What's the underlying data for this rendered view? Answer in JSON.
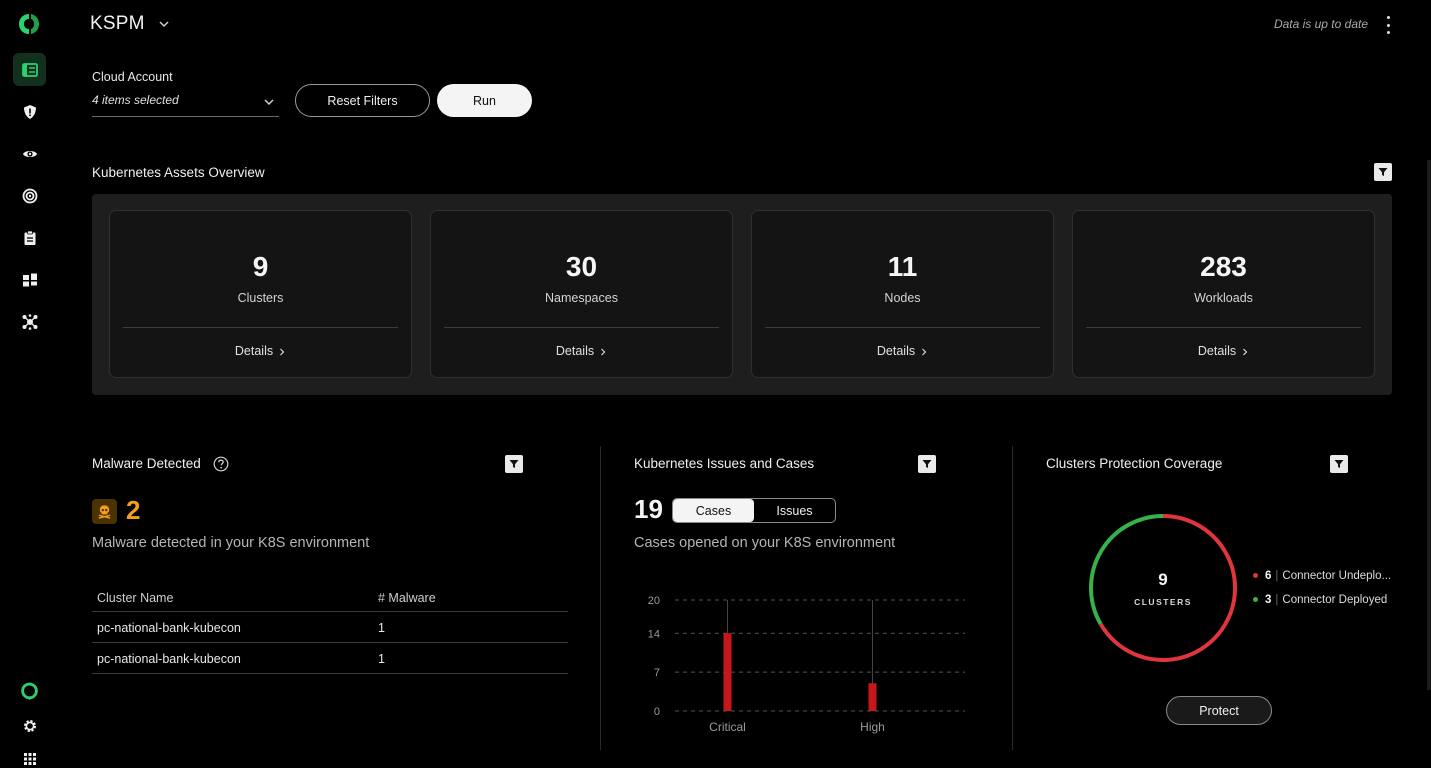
{
  "app": {
    "title": "KSPM",
    "status": "Data is up to date"
  },
  "colors": {
    "accent_green": "#2bd16a",
    "malware_orange": "#f5a015",
    "critical_red": "#e0353c",
    "deployed_green": "#36b24a"
  },
  "sidebar": {
    "items": [
      {
        "icon": "dashboard-icon"
      },
      {
        "icon": "shield-icon"
      },
      {
        "icon": "eye-icon"
      },
      {
        "icon": "target-icon"
      },
      {
        "icon": "clipboard-icon"
      },
      {
        "icon": "assets-icon"
      },
      {
        "icon": "network-icon"
      }
    ],
    "bottom": [
      {
        "icon": "assistant-icon"
      },
      {
        "icon": "gear-icon"
      },
      {
        "icon": "apps-grid-icon"
      }
    ]
  },
  "filters": {
    "label": "Cloud Account",
    "value": "4 items selected",
    "reset_label": "Reset Filters",
    "run_label": "Run"
  },
  "overview": {
    "title": "Kubernetes Assets Overview",
    "cards": [
      {
        "value": "9",
        "label": "Clusters",
        "details": "Details"
      },
      {
        "value": "30",
        "label": "Namespaces",
        "details": "Details"
      },
      {
        "value": "11",
        "label": "Nodes",
        "details": "Details"
      },
      {
        "value": "283",
        "label": "Workloads",
        "details": "Details"
      }
    ]
  },
  "malware": {
    "title": "Malware Detected",
    "count": "2",
    "description": "Malware detected in your K8S environment",
    "columns": [
      "Cluster Name",
      "# Malware"
    ],
    "rows": [
      [
        "pc-national-bank-kubecon",
        "1"
      ],
      [
        "pc-national-bank-kubecon",
        "1"
      ]
    ]
  },
  "issues": {
    "title": "Kubernetes Issues and Cases",
    "count": "19",
    "tabs": [
      "Cases",
      "Issues"
    ],
    "active_tab": "Cases",
    "description": "Cases opened on your K8S environment"
  },
  "chart_data": {
    "type": "bar",
    "categories": [
      "Critical",
      "High"
    ],
    "values": [
      14,
      5
    ],
    "ylim": [
      0,
      20
    ],
    "yticks": [
      "0",
      "7",
      "14",
      "20"
    ],
    "grid": true,
    "color": "#c8161d"
  },
  "coverage": {
    "title": "Clusters Protection Coverage",
    "total": "9",
    "total_label": "CLUSTERS",
    "legend": [
      {
        "count": "6",
        "label": "Connector Undeployed",
        "display": "Connector Undeplo...",
        "color": "#e0353c",
        "value": 6
      },
      {
        "count": "3",
        "label": "Connector Deployed",
        "display": "Connector Deployed",
        "color": "#36b24a",
        "value": 3
      }
    ],
    "button_label": "Protect"
  }
}
